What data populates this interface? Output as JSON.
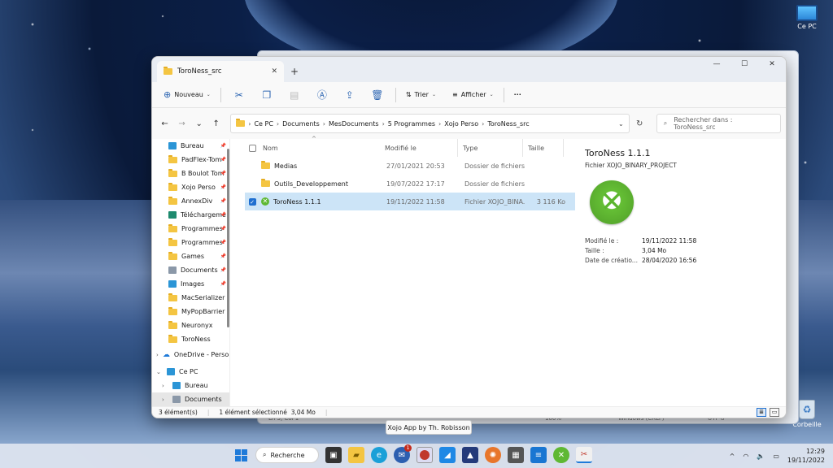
{
  "desktop": {
    "icons": [
      {
        "label": "Ce PC"
      },
      {
        "label": "Corbeille"
      }
    ]
  },
  "background_window": {
    "status": [
      "Ln 3, Col 1",
      "100%",
      "Windows (CRLF)",
      "UTF-8"
    ]
  },
  "window": {
    "tab_title": "ToroNess_src",
    "new_tab": "+",
    "toolbar": {
      "new_label": "Nouveau",
      "sort_label": "Trier",
      "view_label": "Afficher",
      "more_label": "···"
    },
    "breadcrumb": [
      "Ce PC",
      "Documents",
      "MesDocuments",
      "5 Programmes",
      "Xojo Perso",
      "ToroNess_src"
    ],
    "search_placeholder": "Rechercher dans : ToroNess_src",
    "sidebar": {
      "quick_access": [
        {
          "label": "Bureau",
          "pinned": true,
          "icon": "desktop-icon",
          "color": "#2b95d6"
        },
        {
          "label": "PadFlex-Tom",
          "pinned": true,
          "icon": "folder-icon",
          "color": "#f4c542"
        },
        {
          "label": "B Boulot Tom",
          "pinned": true,
          "icon": "folder-icon",
          "color": "#f4c542"
        },
        {
          "label": "Xojo Perso",
          "pinned": true,
          "icon": "folder-icon",
          "color": "#f4c542"
        },
        {
          "label": "AnnexDiv",
          "pinned": true,
          "icon": "folder-icon",
          "color": "#f4c542"
        },
        {
          "label": "Téléchargeme",
          "pinned": true,
          "icon": "download-icon",
          "color": "#1e8a6e"
        },
        {
          "label": "Programmes",
          "pinned": true,
          "icon": "folder-icon",
          "color": "#f4c542"
        },
        {
          "label": "Programmes",
          "pinned": true,
          "icon": "folder-icon",
          "color": "#f4c542"
        },
        {
          "label": "Games",
          "pinned": true,
          "icon": "folder-icon",
          "color": "#f4c542"
        },
        {
          "label": "Documents",
          "pinned": true,
          "icon": "document-icon",
          "color": "#8b98a8"
        },
        {
          "label": "Images",
          "pinned": true,
          "icon": "images-icon",
          "color": "#2b95d6"
        },
        {
          "label": "MacSerializer",
          "pinned": false,
          "icon": "folder-icon",
          "color": "#f4c542"
        },
        {
          "label": "MyPopBarrier",
          "pinned": false,
          "icon": "folder-icon",
          "color": "#f4c542"
        },
        {
          "label": "Neuronyx",
          "pinned": false,
          "icon": "folder-icon",
          "color": "#f4c542"
        },
        {
          "label": "ToroNess",
          "pinned": false,
          "icon": "folder-icon",
          "color": "#f4c542"
        }
      ],
      "onedrive": "OneDrive - Person",
      "this_pc": "Ce PC",
      "this_pc_children": [
        {
          "label": "Bureau",
          "icon": "desktop-icon",
          "color": "#2b95d6"
        },
        {
          "label": "Documents",
          "icon": "document-icon",
          "color": "#8b98a8"
        }
      ]
    },
    "columns": {
      "name": "Nom",
      "modified": "Modifié le",
      "type": "Type",
      "size": "Taille"
    },
    "files": [
      {
        "name": "Medias",
        "modified": "27/01/2021 20:53",
        "type": "Dossier de fichiers",
        "size": "",
        "kind": "folder",
        "selected": false
      },
      {
        "name": "Outils_Developpement",
        "modified": "19/07/2022 17:17",
        "type": "Dossier de fichiers",
        "size": "",
        "kind": "folder",
        "selected": false
      },
      {
        "name": "ToroNess 1.1.1",
        "modified": "19/11/2022 11:58",
        "type": "Fichier XOJO_BINA...",
        "size": "3 116 Ko",
        "kind": "xojo",
        "selected": true
      }
    ],
    "details": {
      "title": "ToroNess 1.1.1",
      "subtitle": "Fichier XOJO_BINARY_PROJECT",
      "props": [
        {
          "k": "Modifié le :",
          "v": "19/11/2022 11:58"
        },
        {
          "k": "Taille :",
          "v": "3,04 Mo"
        },
        {
          "k": "Date de créatio...",
          "v": "28/04/2020 16:56"
        }
      ]
    },
    "status": {
      "count": "3 élément(s)",
      "selection": "1 élément sélectionné",
      "size": "3,04 Mo"
    }
  },
  "tooltip": "Xojo App by Th. Robisson",
  "taskbar": {
    "search_label": "Recherche",
    "badge_count": "1",
    "time": "12:29",
    "date": "19/11/2022"
  }
}
